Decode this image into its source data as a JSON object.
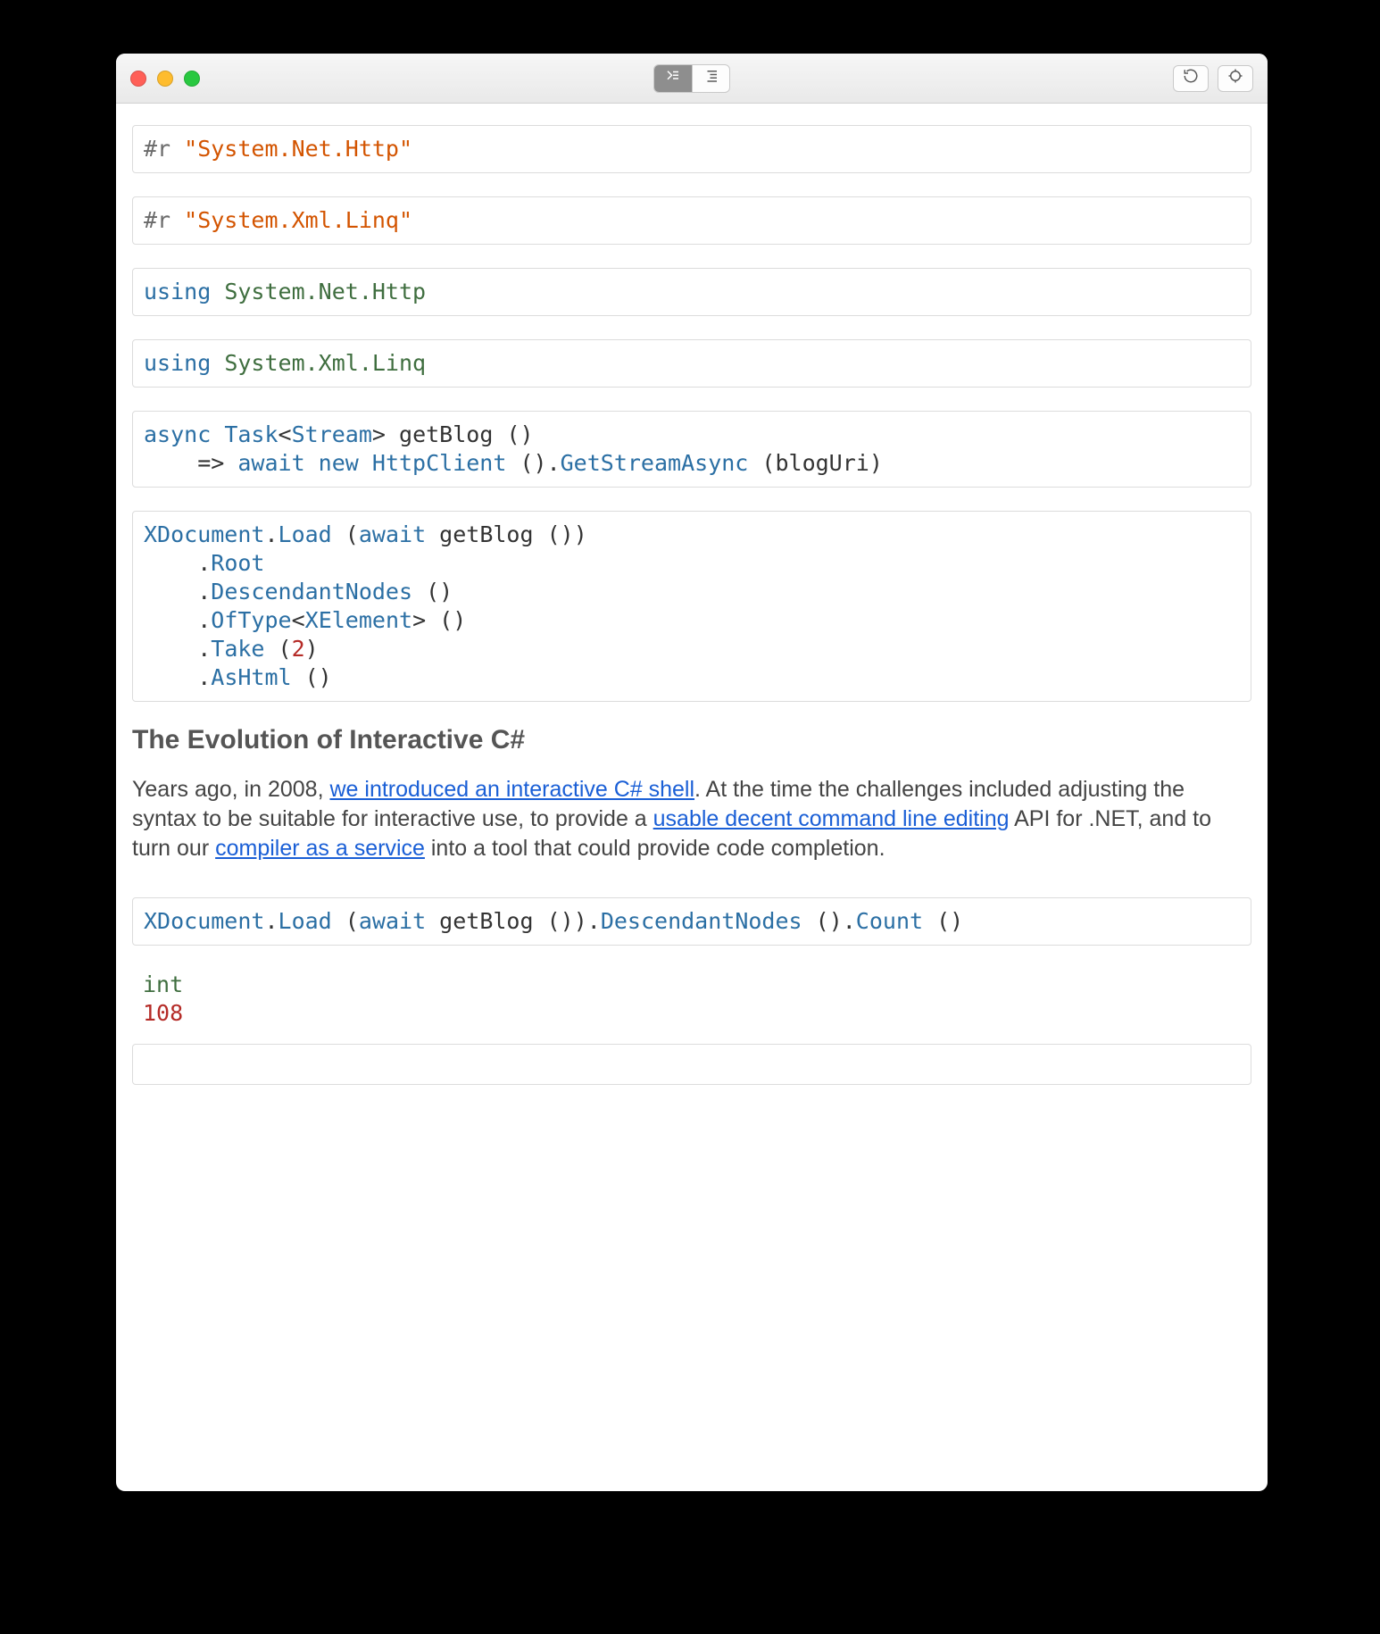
{
  "window": {
    "traffic": [
      "close",
      "minimize",
      "zoom"
    ],
    "segmented": {
      "active_index": 0,
      "buttons": [
        "code-mode",
        "outline-mode"
      ]
    },
    "tools": [
      "reload",
      "target"
    ]
  },
  "cells": [
    {
      "id": "c0",
      "tokens": [
        {
          "t": "#r ",
          "c": "tok-directive"
        },
        {
          "t": "\"System.Net.Http\"",
          "c": "tok-string"
        }
      ]
    },
    {
      "id": "c1",
      "tokens": [
        {
          "t": "#r ",
          "c": "tok-directive"
        },
        {
          "t": "\"System.Xml.Linq\"",
          "c": "tok-string"
        }
      ]
    },
    {
      "id": "c2",
      "tokens": [
        {
          "t": "using ",
          "c": "tok-keyword"
        },
        {
          "t": "System.Net.Http",
          "c": "tok-ns"
        }
      ]
    },
    {
      "id": "c3",
      "tokens": [
        {
          "t": "using ",
          "c": "tok-keyword"
        },
        {
          "t": "System.Xml.Linq",
          "c": "tok-ns"
        }
      ]
    },
    {
      "id": "c4",
      "tokens": [
        {
          "t": "async ",
          "c": "tok-keyword"
        },
        {
          "t": "Task",
          "c": "tok-type"
        },
        {
          "t": "<",
          "c": "tok-ident"
        },
        {
          "t": "Stream",
          "c": "tok-type"
        },
        {
          "t": "> ",
          "c": "tok-ident"
        },
        {
          "t": "getBlog ",
          "c": "tok-ident"
        },
        {
          "t": "()",
          "c": "tok-ident"
        },
        {
          "t": "\n    => ",
          "c": "tok-ident"
        },
        {
          "t": "await ",
          "c": "tok-await"
        },
        {
          "t": "new ",
          "c": "tok-keyword"
        },
        {
          "t": "HttpClient ",
          "c": "tok-type"
        },
        {
          "t": "().",
          "c": "tok-ident"
        },
        {
          "t": "GetStreamAsync ",
          "c": "tok-method"
        },
        {
          "t": "(",
          "c": "tok-ident"
        },
        {
          "t": "blogUri",
          "c": "tok-ident"
        },
        {
          "t": ")",
          "c": "tok-ident"
        }
      ]
    },
    {
      "id": "c5",
      "tokens": [
        {
          "t": "XDocument",
          "c": "tok-type"
        },
        {
          "t": ".",
          "c": "tok-ident"
        },
        {
          "t": "Load ",
          "c": "tok-method"
        },
        {
          "t": "(",
          "c": "tok-ident"
        },
        {
          "t": "await ",
          "c": "tok-await"
        },
        {
          "t": "getBlog ",
          "c": "tok-ident"
        },
        {
          "t": "())",
          "c": "tok-ident"
        },
        {
          "t": "\n    .",
          "c": "tok-ident"
        },
        {
          "t": "Root",
          "c": "tok-method"
        },
        {
          "t": "\n    .",
          "c": "tok-ident"
        },
        {
          "t": "DescendantNodes ",
          "c": "tok-method"
        },
        {
          "t": "()",
          "c": "tok-ident"
        },
        {
          "t": "\n    .",
          "c": "tok-ident"
        },
        {
          "t": "OfType",
          "c": "tok-method"
        },
        {
          "t": "<",
          "c": "tok-ident"
        },
        {
          "t": "XElement",
          "c": "tok-type"
        },
        {
          "t": "> ()",
          "c": "tok-ident"
        },
        {
          "t": "\n    .",
          "c": "tok-ident"
        },
        {
          "t": "Take ",
          "c": "tok-method"
        },
        {
          "t": "(",
          "c": "tok-ident"
        },
        {
          "t": "2",
          "c": "tok-num"
        },
        {
          "t": ")",
          "c": "tok-ident"
        },
        {
          "t": "\n    .",
          "c": "tok-ident"
        },
        {
          "t": "AsHtml ",
          "c": "tok-method"
        },
        {
          "t": "()",
          "c": "tok-ident"
        }
      ]
    },
    {
      "id": "c6",
      "tokens": [
        {
          "t": "XDocument",
          "c": "tok-type"
        },
        {
          "t": ".",
          "c": "tok-ident"
        },
        {
          "t": "Load ",
          "c": "tok-method"
        },
        {
          "t": "(",
          "c": "tok-ident"
        },
        {
          "t": "await ",
          "c": "tok-await"
        },
        {
          "t": "getBlog ",
          "c": "tok-ident"
        },
        {
          "t": "()).",
          "c": "tok-ident"
        },
        {
          "t": "DescendantNodes ",
          "c": "tok-method"
        },
        {
          "t": "().",
          "c": "tok-ident"
        },
        {
          "t": "Count ",
          "c": "tok-method"
        },
        {
          "t": "()",
          "c": "tok-ident"
        }
      ]
    }
  ],
  "rendered_output": {
    "heading": "The Evolution of Interactive C#",
    "paragraph_parts": [
      {
        "t": "Years ago, in 2008, ",
        "link": false
      },
      {
        "t": "we introduced an interactive C# shell",
        "link": true
      },
      {
        "t": ". At the time the challenges included adjusting the syntax to be suitable for interactive use, to provide a ",
        "link": false
      },
      {
        "t": "usable decent command line editing",
        "link": true
      },
      {
        "t": " API for .NET, and to turn our ",
        "link": false
      },
      {
        "t": "compiler as a service",
        "link": true
      },
      {
        "t": " into a tool that could provide code completion.",
        "link": false
      }
    ]
  },
  "result": {
    "type": "int",
    "value": "108"
  }
}
